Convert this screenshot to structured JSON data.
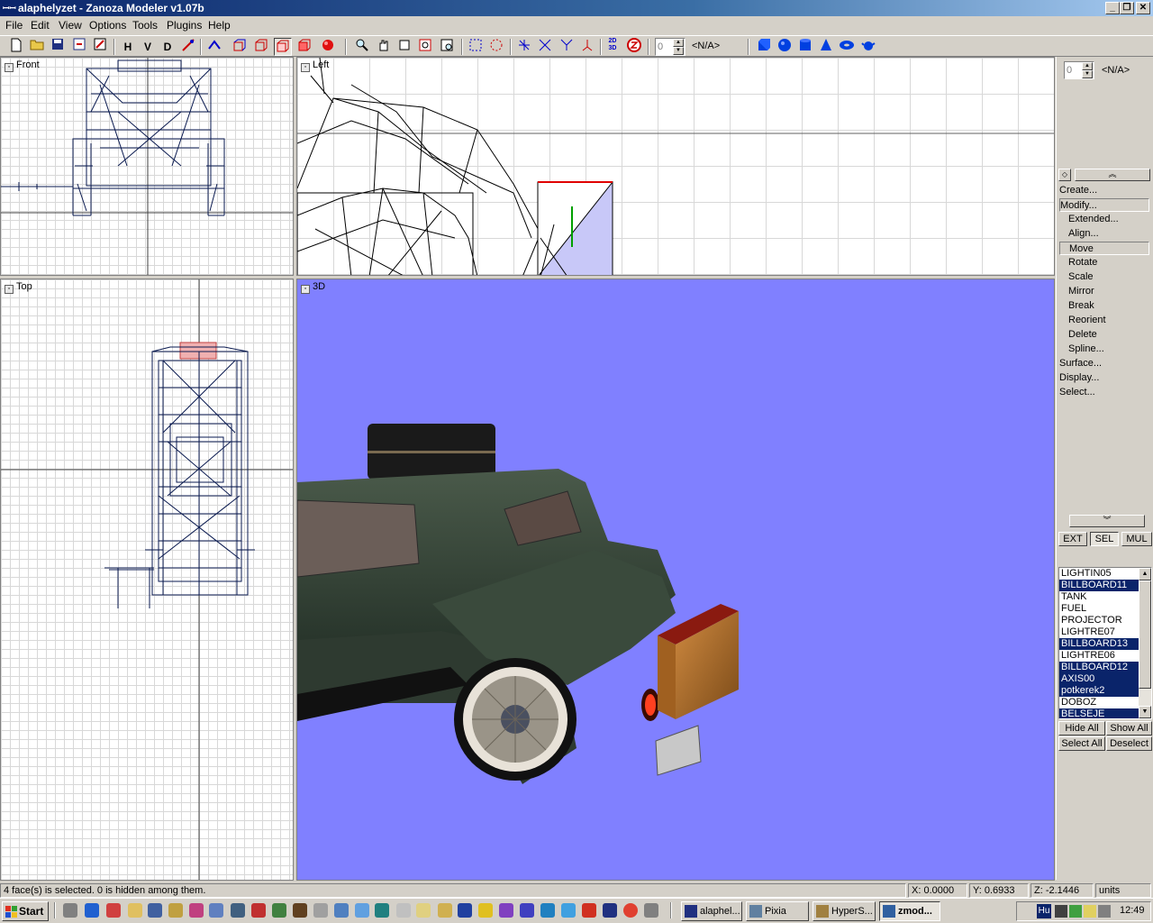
{
  "window": {
    "title": "alaphelyzet - Zanoza Modeler v1.07b",
    "minimize": "_",
    "maximize": "❐",
    "close": "✕"
  },
  "menu": [
    "File",
    "Edit",
    "View",
    "Options",
    "Tools",
    "Plugins",
    "Help"
  ],
  "toolbar": {
    "letters": [
      "H",
      "V",
      "D"
    ],
    "spin_value": "0",
    "spin_na": "<N/A>"
  },
  "viewports": {
    "front": "Front",
    "left": "Left",
    "top": "Top",
    "persp": "3D"
  },
  "panel": {
    "spin_value": "0",
    "spin_na": "<N/A>",
    "commands": [
      {
        "label": "Create...",
        "sub": false,
        "active": false
      },
      {
        "label": "Modify...",
        "sub": false,
        "active": true
      },
      {
        "label": "Extended...",
        "sub": true,
        "active": false
      },
      {
        "label": "Align...",
        "sub": true,
        "active": false
      },
      {
        "label": "Move",
        "sub": true,
        "active": true
      },
      {
        "label": "Rotate",
        "sub": true,
        "active": false
      },
      {
        "label": "Scale",
        "sub": true,
        "active": false
      },
      {
        "label": "Mirror",
        "sub": true,
        "active": false
      },
      {
        "label": "Break",
        "sub": true,
        "active": false
      },
      {
        "label": "Reorient",
        "sub": true,
        "active": false
      },
      {
        "label": "Delete",
        "sub": true,
        "active": false
      },
      {
        "label": "Spline...",
        "sub": true,
        "active": false
      },
      {
        "label": "Surface...",
        "sub": false,
        "active": false
      },
      {
        "label": "Display...",
        "sub": false,
        "active": false
      },
      {
        "label": "Select...",
        "sub": false,
        "active": false
      }
    ],
    "modes": [
      "EXT",
      "SEL",
      "MUL"
    ],
    "objects": [
      {
        "name": "LIGHTIN05",
        "selected": false
      },
      {
        "name": "BILLBOARD11",
        "selected": true
      },
      {
        "name": "TANK",
        "selected": false
      },
      {
        "name": "FUEL",
        "selected": false
      },
      {
        "name": "PROJECTOR",
        "selected": false
      },
      {
        "name": "LIGHTRE07",
        "selected": false
      },
      {
        "name": "BILLBOARD13",
        "selected": true
      },
      {
        "name": "LIGHTRE06",
        "selected": false
      },
      {
        "name": "BILLBOARD12",
        "selected": true
      },
      {
        "name": "AXIS00",
        "selected": true
      },
      {
        "name": "potkerek2",
        "selected": true
      },
      {
        "name": "DOBOZ",
        "selected": false
      },
      {
        "name": "BELSEJE",
        "selected": true
      }
    ],
    "hide_all": "Hide All",
    "show_all": "Show All",
    "select_all": "Select All",
    "deselect": "Deselect"
  },
  "status": {
    "message": "4 face(s) is selected. 0 is hidden among them.",
    "x": "X: 0.0000",
    "y": "Y: 0.6933",
    "z": "Z: -2.1446",
    "units": "units"
  },
  "taskbar": {
    "start": "Start",
    "tasks": [
      {
        "label": "alaphel...",
        "pressed": false
      },
      {
        "label": "Pixia",
        "pressed": false
      },
      {
        "label": "HyperS...",
        "pressed": false
      },
      {
        "label": "zmod...",
        "pressed": true
      }
    ],
    "lang": "Hu",
    "clock": "12:49"
  },
  "colors": {
    "viewport_3d_bg": "#8080ff",
    "selection": "#0a246a",
    "titlebar": "#0a246a"
  }
}
